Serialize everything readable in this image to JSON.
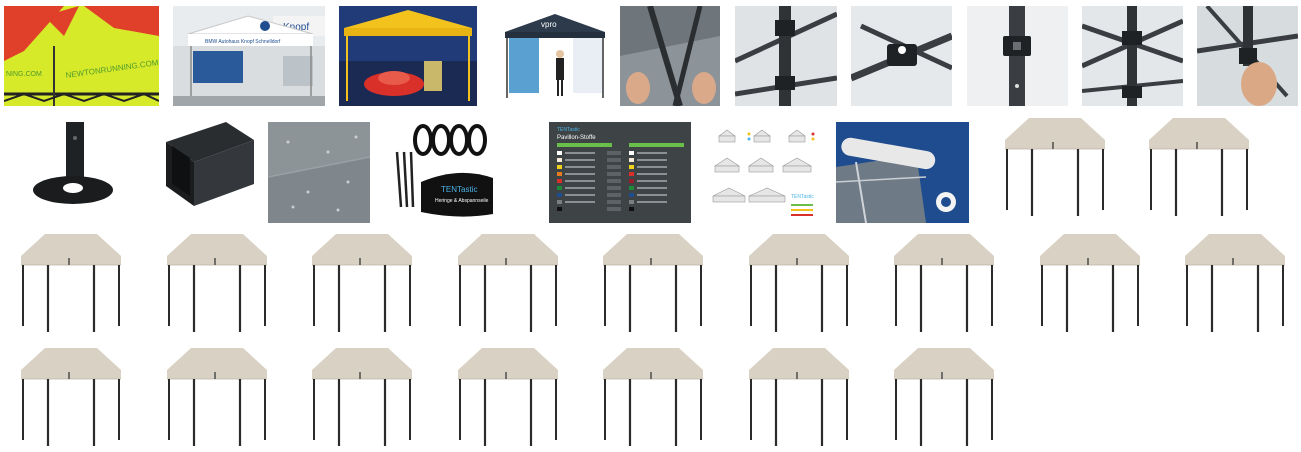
{
  "gallery": {
    "row1": [
      {
        "name": "tent-neon-print-photo",
        "caption": "NEWTONRUNNING.COM"
      },
      {
        "name": "tent-bmw-dealer-photo",
        "caption": "BMW Autohaus Knopf Schnelldorf",
        "sign": "Knopf"
      },
      {
        "name": "tent-yellow-night-photo"
      },
      {
        "name": "tent-booth-photo"
      },
      {
        "name": "frame-hands-photo"
      },
      {
        "name": "frame-joint-photo"
      },
      {
        "name": "frame-bracket-photo"
      },
      {
        "name": "frame-leg-photo"
      },
      {
        "name": "frame-truss-photo"
      },
      {
        "name": "frame-hand-adjust-photo"
      }
    ],
    "row2": [
      {
        "name": "foot-plate-photo"
      },
      {
        "name": "square-profile-photo"
      },
      {
        "name": "fabric-rain-photo"
      },
      {
        "name": "accessories-photo",
        "bag_brand": "TENTastic",
        "bag_caption": "Heringe & Abspannseile"
      },
      {
        "name": "color-chart-photo",
        "brand": "TENTastic",
        "title": "Pavillon-Stoffe"
      },
      {
        "name": "size-chart-photo",
        "brand": "TENTastic"
      },
      {
        "name": "sidewall-roll-photo"
      }
    ],
    "tent_color": "#d9d2c4",
    "frame_color": "#2b2b2b",
    "tent_count_row2": 2,
    "tent_count_row3": 9,
    "tent_count_row4": 7
  },
  "colors": {
    "neon": "#d7ea2a",
    "dark_blue": "#1e4c8f",
    "yellow": "#f3c21c",
    "dark_panel": "#3e4346",
    "frame_grey": "#3a3e42"
  }
}
